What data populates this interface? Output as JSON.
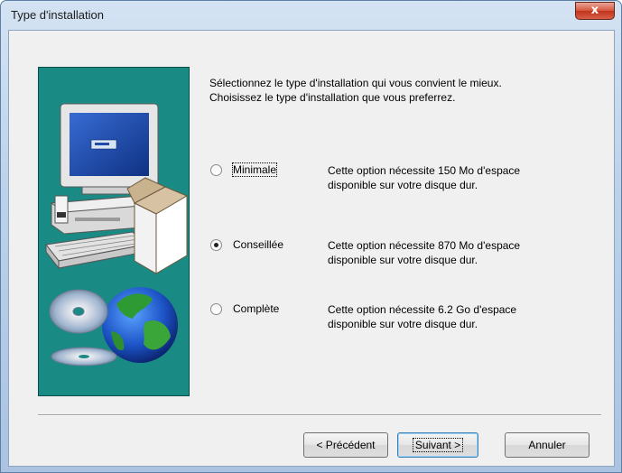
{
  "window": {
    "title": "Type d'installation",
    "close_label": "x"
  },
  "intro": {
    "line1": "Sélectionnez le type d'installation qui vous convient le mieux.",
    "line2": "Choisissez le type d'installation que vous preferrez."
  },
  "options": [
    {
      "label": "Minimale",
      "desc_line1": "Cette option nécessite  150 Mo d'espace",
      "desc_line2": "disponible sur votre disque dur.",
      "selected": false
    },
    {
      "label": "Conseillée",
      "desc_line1": "Cette option nécessite  870 Mo d'espace",
      "desc_line2": "disponible sur votre disque dur.",
      "selected": true
    },
    {
      "label": "Complète",
      "desc_line1": "Cette option nécessite 6.2 Go d'espace",
      "desc_line2": "disponible sur votre disque dur.",
      "selected": false
    }
  ],
  "buttons": {
    "back": "< Précédent",
    "next": "Suivant >",
    "cancel": "Annuler"
  },
  "colors": {
    "panel_teal": "#1a8a85",
    "close_red": "#c2331b"
  },
  "icons": {
    "illustration": "computer-globe-cd-illustration"
  }
}
